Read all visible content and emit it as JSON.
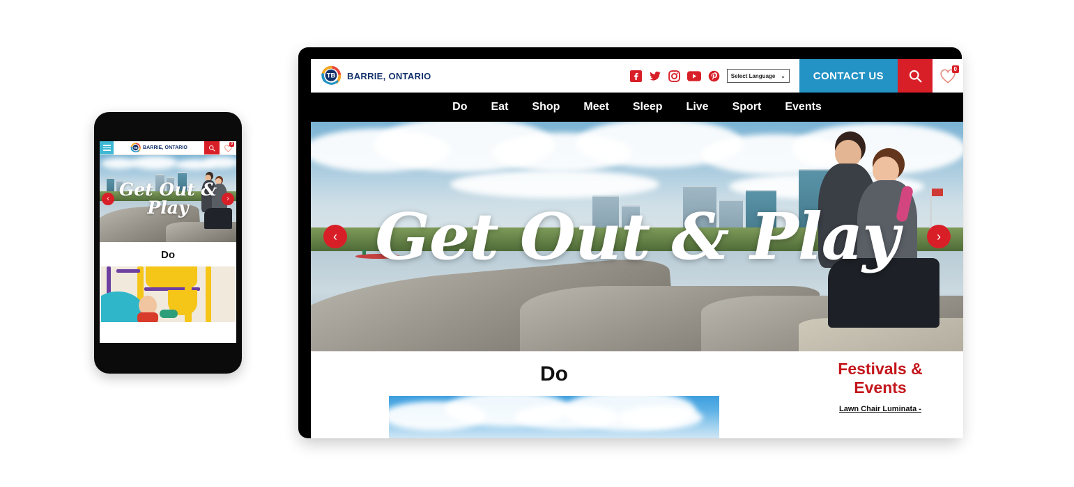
{
  "site": {
    "brand_name": "BARRIE, ONTARIO",
    "logo_mark": "TB",
    "logo_icon": "tourism-barrie-swoosh-logo"
  },
  "colors": {
    "brand_navy": "#13326b",
    "accent_red": "#d81f28",
    "contact_blue": "#2392c4",
    "heading_red": "#c4161c",
    "nav_bar": "#000000",
    "burger_cyan": "#3fb8d4"
  },
  "header": {
    "social_links": [
      {
        "name": "facebook-icon",
        "label": "Facebook"
      },
      {
        "name": "twitter-icon",
        "label": "Twitter"
      },
      {
        "name": "instagram-icon",
        "label": "Instagram"
      },
      {
        "name": "youtube-icon",
        "label": "YouTube"
      },
      {
        "name": "pinterest-icon",
        "label": "Pinterest"
      }
    ],
    "language_select": {
      "value": "Select Language",
      "chevron": "⌄"
    },
    "contact_label": "CONTACT US",
    "search_icon": "search-icon",
    "favorites": {
      "icon": "heart-icon",
      "count": "0"
    }
  },
  "nav": {
    "items": [
      {
        "label": "Do"
      },
      {
        "label": "Eat"
      },
      {
        "label": "Shop"
      },
      {
        "label": "Meet"
      },
      {
        "label": "Sleep"
      },
      {
        "label": "Live"
      },
      {
        "label": "Sport"
      },
      {
        "label": "Events"
      }
    ]
  },
  "hero": {
    "headline": "Get Out & Play",
    "headline_line1": "Get Out &",
    "headline_line2": "Play",
    "prev_arrow": "‹",
    "next_arrow": "›",
    "image_alt": "Couple sitting on rocky waterfront with Barrie skyline"
  },
  "content": {
    "section_title": "Do",
    "section_image_alt": "Blue sky with clouds",
    "sidebar_title_line1": "Festivals &",
    "sidebar_title_line2": "Events",
    "sidebar_first_event": "Lawn Chair Luminata -"
  },
  "mobile": {
    "menu_icon": "hamburger-menu-icon",
    "brand_name": "BARRIE, ONTARIO",
    "search_icon": "search-icon",
    "favorites_count": "0",
    "hero_line1": "Get Out &",
    "hero_line2": "Play",
    "section_title": "Do",
    "card_image_alt": "Child playing on indoor playground"
  }
}
